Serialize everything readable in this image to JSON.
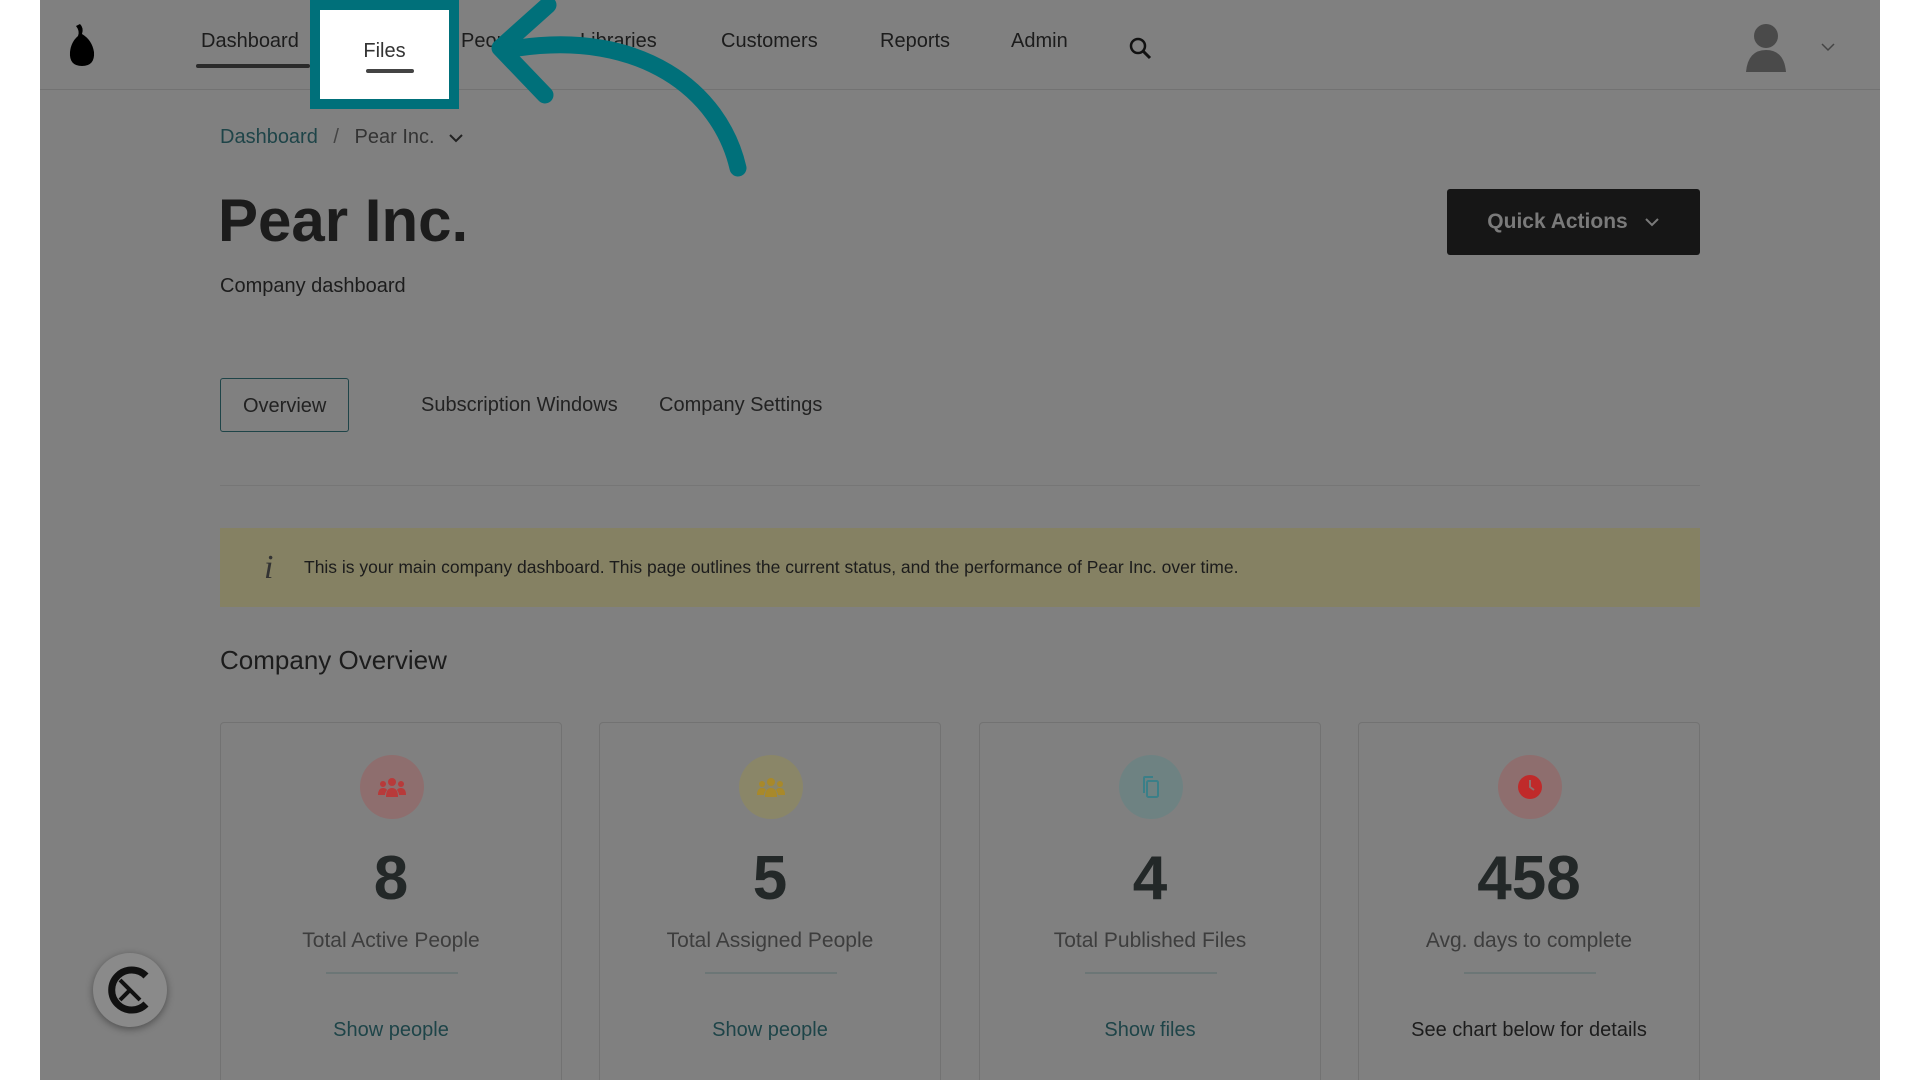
{
  "nav": {
    "items": [
      "Dashboard",
      "Files",
      "People",
      "Libraries",
      "Customers",
      "Reports",
      "Admin"
    ],
    "active": "Dashboard",
    "highlighted": "Files"
  },
  "breadcrumb": {
    "root": "Dashboard",
    "separator": "/",
    "current": "Pear Inc."
  },
  "header": {
    "title": "Pear Inc.",
    "subtitle": "Company dashboard",
    "quick_actions": "Quick Actions"
  },
  "tabs": [
    "Overview",
    "Subscription Windows",
    "Company Settings"
  ],
  "info": {
    "text": "This is your main company dashboard. This page outlines the current status, and the performance of Pear Inc. over time."
  },
  "overview": {
    "title": "Company Overview",
    "cards": [
      {
        "icon": "people-icon",
        "color": "#b83a3a",
        "value": "8",
        "label": "Total Active People",
        "link": "Show people"
      },
      {
        "icon": "people-icon",
        "color": "#b89a2a",
        "value": "5",
        "label": "Total Assigned People",
        "link": "Show people"
      },
      {
        "icon": "copy-files-icon",
        "color": "#3a7f88",
        "value": "4",
        "label": "Total Published Files",
        "link": "Show files"
      },
      {
        "icon": "clock-icon",
        "color": "#c02a2a",
        "value": "458",
        "label": "Avg. days to complete",
        "link": "See chart below for details"
      }
    ]
  },
  "annotation_color": "#00707a"
}
